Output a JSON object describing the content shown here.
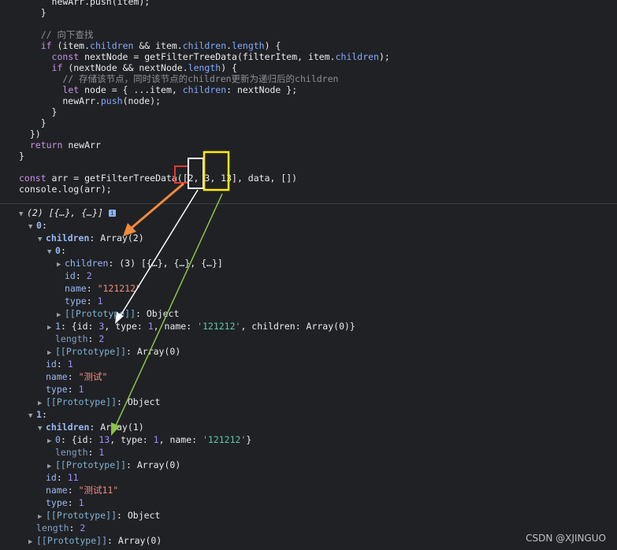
{
  "code_lines": [
    [
      {
        "t": "      newArr.push(item);",
        "c": "fn"
      }
    ],
    [
      {
        "t": "    }",
        "c": "fn"
      }
    ],
    [
      {
        "t": "",
        "c": "fn"
      }
    ],
    [
      {
        "t": "    // 向下查找",
        "c": "cm"
      }
    ],
    [
      {
        "t": "    ",
        "c": "fn"
      },
      {
        "t": "if",
        "c": "kw"
      },
      {
        "t": " (item.",
        "c": "fn"
      },
      {
        "t": "children",
        "c": "prop"
      },
      {
        "t": " && item.",
        "c": "fn"
      },
      {
        "t": "children",
        "c": "prop"
      },
      {
        "t": ".",
        "c": "fn"
      },
      {
        "t": "length",
        "c": "prop"
      },
      {
        "t": ") {",
        "c": "fn"
      }
    ],
    [
      {
        "t": "      ",
        "c": "fn"
      },
      {
        "t": "const",
        "c": "kw"
      },
      {
        "t": " nextNode = getFilterTreeData(filterItem, item.",
        "c": "fn"
      },
      {
        "t": "children",
        "c": "prop"
      },
      {
        "t": ");",
        "c": "fn"
      }
    ],
    [
      {
        "t": "      ",
        "c": "fn"
      },
      {
        "t": "if",
        "c": "kw"
      },
      {
        "t": " (nextNode && nextNode.",
        "c": "fn"
      },
      {
        "t": "length",
        "c": "prop"
      },
      {
        "t": ") {",
        "c": "fn"
      }
    ],
    [
      {
        "t": "        // 存储该节点，同时该节点的children更新为递归后的children",
        "c": "cm"
      }
    ],
    [
      {
        "t": "        ",
        "c": "fn"
      },
      {
        "t": "let",
        "c": "kw"
      },
      {
        "t": " node = { ...item, ",
        "c": "fn"
      },
      {
        "t": "children",
        "c": "prop"
      },
      {
        "t": ": nextNode };",
        "c": "fn"
      }
    ],
    [
      {
        "t": "        newArr.",
        "c": "fn"
      },
      {
        "t": "push",
        "c": "prop"
      },
      {
        "t": "(node);",
        "c": "fn"
      }
    ],
    [
      {
        "t": "      }",
        "c": "fn"
      }
    ],
    [
      {
        "t": "    }",
        "c": "fn"
      }
    ],
    [
      {
        "t": "  })",
        "c": "fn"
      }
    ],
    [
      {
        "t": "  ",
        "c": "fn"
      },
      {
        "t": "return",
        "c": "kw"
      },
      {
        "t": " newArr",
        "c": "fn"
      }
    ],
    [
      {
        "t": "}",
        "c": "fn"
      }
    ],
    [
      {
        "t": "",
        "c": "fn"
      }
    ],
    [
      {
        "t": "const",
        "c": "kw"
      },
      {
        "t": " arr = getFilterTreeData([2, 3, 13], data, [])",
        "c": "fn"
      }
    ],
    [
      {
        "t": "console",
        "c": "fn"
      },
      {
        "t": ".log(arr);",
        "c": "fn"
      }
    ]
  ],
  "console": {
    "summary": "(2) [{…}, {…}]",
    "info_icon": "i",
    "rows": [
      {
        "indent": 0,
        "tri": "open",
        "parts": [
          {
            "t": "(2) [{…}, {…}] ",
            "c": "v it"
          }
        ],
        "info": true
      },
      {
        "indent": 1,
        "tri": "open",
        "parts": [
          {
            "t": "0",
            "c": "k"
          },
          {
            "t": ":",
            "c": "v"
          }
        ]
      },
      {
        "indent": 2,
        "tri": "open",
        "parts": [
          {
            "t": "children",
            "c": "k"
          },
          {
            "t": ": Array(2)",
            "c": "v"
          }
        ]
      },
      {
        "indent": 3,
        "tri": "open",
        "parts": [
          {
            "t": "0",
            "c": "k"
          },
          {
            "t": ":",
            "c": "v"
          }
        ]
      },
      {
        "indent": 4,
        "tri": "closed",
        "parts": [
          {
            "t": "children",
            "c": "kp"
          },
          {
            "t": ": (3) [{…}, {…}, {…}]",
            "c": "v"
          }
        ]
      },
      {
        "indent": 4,
        "tri": "none",
        "parts": [
          {
            "t": "id",
            "c": "kp"
          },
          {
            "t": ": ",
            "c": "v"
          },
          {
            "t": "2",
            "c": "vn"
          }
        ]
      },
      {
        "indent": 4,
        "tri": "none",
        "parts": [
          {
            "t": "name",
            "c": "kp"
          },
          {
            "t": ": ",
            "c": "v"
          },
          {
            "t": "\"121212\"",
            "c": "vs"
          }
        ]
      },
      {
        "indent": 4,
        "tri": "none",
        "parts": [
          {
            "t": "type",
            "c": "kp"
          },
          {
            "t": ": ",
            "c": "v"
          },
          {
            "t": "1",
            "c": "vn"
          }
        ]
      },
      {
        "indent": 4,
        "tri": "closed",
        "parts": [
          {
            "t": "[[Prototype]]",
            "c": "pk"
          },
          {
            "t": ": Object",
            "c": "v"
          }
        ]
      },
      {
        "indent": 3,
        "tri": "closed",
        "parts": [
          {
            "t": "1",
            "c": "kp"
          },
          {
            "t": ": {id: ",
            "c": "v"
          },
          {
            "t": "3",
            "c": "vn"
          },
          {
            "t": ", type: ",
            "c": "v"
          },
          {
            "t": "1",
            "c": "vn"
          },
          {
            "t": ", name: ",
            "c": "v"
          },
          {
            "t": "'121212'",
            "c": "vsq"
          },
          {
            "t": ", children: Array(0)}",
            "c": "v"
          }
        ]
      },
      {
        "indent": 3,
        "tri": "none",
        "parts": [
          {
            "t": "length",
            "c": "kd"
          },
          {
            "t": ": ",
            "c": "v"
          },
          {
            "t": "2",
            "c": "vn"
          }
        ]
      },
      {
        "indent": 3,
        "tri": "closed",
        "parts": [
          {
            "t": "[[Prototype]]",
            "c": "pk"
          },
          {
            "t": ": Array(0)",
            "c": "v"
          }
        ]
      },
      {
        "indent": 2,
        "tri": "none",
        "parts": [
          {
            "t": "id",
            "c": "kp"
          },
          {
            "t": ": ",
            "c": "v"
          },
          {
            "t": "1",
            "c": "vn"
          }
        ]
      },
      {
        "indent": 2,
        "tri": "none",
        "parts": [
          {
            "t": "name",
            "c": "kp"
          },
          {
            "t": ": ",
            "c": "v"
          },
          {
            "t": "\"测试\"",
            "c": "vs"
          }
        ]
      },
      {
        "indent": 2,
        "tri": "none",
        "parts": [
          {
            "t": "type",
            "c": "kp"
          },
          {
            "t": ": ",
            "c": "v"
          },
          {
            "t": "1",
            "c": "vn"
          }
        ]
      },
      {
        "indent": 2,
        "tri": "closed",
        "parts": [
          {
            "t": "[[Prototype]]",
            "c": "pk"
          },
          {
            "t": ": Object",
            "c": "v"
          }
        ]
      },
      {
        "indent": 1,
        "tri": "open",
        "parts": [
          {
            "t": "1",
            "c": "k"
          },
          {
            "t": ":",
            "c": "v"
          }
        ]
      },
      {
        "indent": 2,
        "tri": "open",
        "parts": [
          {
            "t": "children",
            "c": "k"
          },
          {
            "t": ": Array(1)",
            "c": "v"
          }
        ]
      },
      {
        "indent": 3,
        "tri": "closed",
        "parts": [
          {
            "t": "0",
            "c": "kp"
          },
          {
            "t": ": {id: ",
            "c": "v"
          },
          {
            "t": "13",
            "c": "vn"
          },
          {
            "t": ", type: ",
            "c": "v"
          },
          {
            "t": "1",
            "c": "vn"
          },
          {
            "t": ", name: ",
            "c": "v"
          },
          {
            "t": "'121212'",
            "c": "vsq"
          },
          {
            "t": "}",
            "c": "v"
          }
        ]
      },
      {
        "indent": 3,
        "tri": "none",
        "parts": [
          {
            "t": "length",
            "c": "kd"
          },
          {
            "t": ": ",
            "c": "v"
          },
          {
            "t": "1",
            "c": "vn"
          }
        ]
      },
      {
        "indent": 3,
        "tri": "closed",
        "parts": [
          {
            "t": "[[Prototype]]",
            "c": "pk"
          },
          {
            "t": ": Array(0)",
            "c": "v"
          }
        ]
      },
      {
        "indent": 2,
        "tri": "none",
        "parts": [
          {
            "t": "id",
            "c": "kp"
          },
          {
            "t": ": ",
            "c": "v"
          },
          {
            "t": "11",
            "c": "vn"
          }
        ]
      },
      {
        "indent": 2,
        "tri": "none",
        "parts": [
          {
            "t": "name",
            "c": "kp"
          },
          {
            "t": ": ",
            "c": "v"
          },
          {
            "t": "\"测试11\"",
            "c": "vs"
          }
        ]
      },
      {
        "indent": 2,
        "tri": "none",
        "parts": [
          {
            "t": "type",
            "c": "kp"
          },
          {
            "t": ": ",
            "c": "v"
          },
          {
            "t": "1",
            "c": "vn"
          }
        ]
      },
      {
        "indent": 2,
        "tri": "closed",
        "parts": [
          {
            "t": "[[Prototype]]",
            "c": "pk"
          },
          {
            "t": ": Object",
            "c": "v"
          }
        ]
      },
      {
        "indent": 1,
        "tri": "none",
        "parts": [
          {
            "t": "length",
            "c": "kd"
          },
          {
            "t": ": ",
            "c": "v"
          },
          {
            "t": "2",
            "c": "vn"
          }
        ]
      },
      {
        "indent": 1,
        "tri": "closed",
        "parts": [
          {
            "t": "[[Prototype]]",
            "c": "pk"
          },
          {
            "t": ": Array(0)",
            "c": "v"
          }
        ]
      }
    ]
  },
  "annotations": {
    "colors": {
      "red": "#e53935",
      "white": "#ffffff",
      "yellow": "#ffee00",
      "orange": "#f08a3c",
      "green": "#8bc34a"
    }
  },
  "watermark": "CSDN @XJINGUO"
}
